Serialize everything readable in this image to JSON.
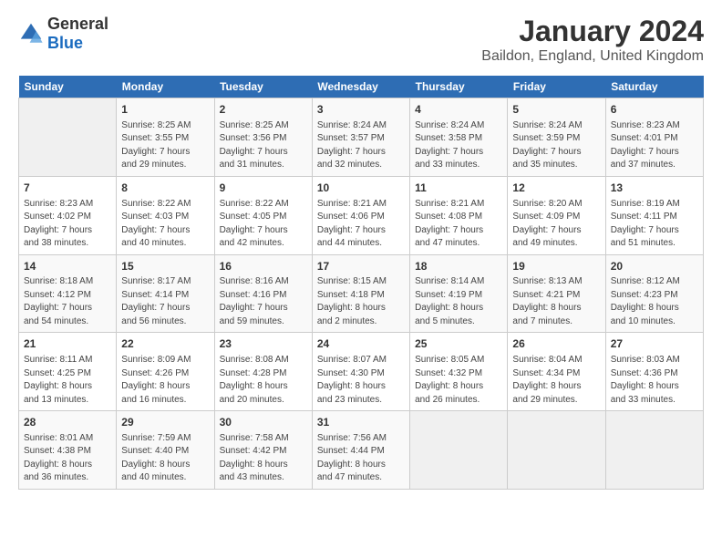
{
  "logo": {
    "text_general": "General",
    "text_blue": "Blue"
  },
  "header": {
    "title": "January 2024",
    "subtitle": "Baildon, England, United Kingdom"
  },
  "calendar": {
    "days_of_week": [
      "Sunday",
      "Monday",
      "Tuesday",
      "Wednesday",
      "Thursday",
      "Friday",
      "Saturday"
    ],
    "weeks": [
      [
        {
          "day": "",
          "detail": ""
        },
        {
          "day": "1",
          "detail": "Sunrise: 8:25 AM\nSunset: 3:55 PM\nDaylight: 7 hours\nand 29 minutes."
        },
        {
          "day": "2",
          "detail": "Sunrise: 8:25 AM\nSunset: 3:56 PM\nDaylight: 7 hours\nand 31 minutes."
        },
        {
          "day": "3",
          "detail": "Sunrise: 8:24 AM\nSunset: 3:57 PM\nDaylight: 7 hours\nand 32 minutes."
        },
        {
          "day": "4",
          "detail": "Sunrise: 8:24 AM\nSunset: 3:58 PM\nDaylight: 7 hours\nand 33 minutes."
        },
        {
          "day": "5",
          "detail": "Sunrise: 8:24 AM\nSunset: 3:59 PM\nDaylight: 7 hours\nand 35 minutes."
        },
        {
          "day": "6",
          "detail": "Sunrise: 8:23 AM\nSunset: 4:01 PM\nDaylight: 7 hours\nand 37 minutes."
        }
      ],
      [
        {
          "day": "7",
          "detail": "Sunrise: 8:23 AM\nSunset: 4:02 PM\nDaylight: 7 hours\nand 38 minutes."
        },
        {
          "day": "8",
          "detail": "Sunrise: 8:22 AM\nSunset: 4:03 PM\nDaylight: 7 hours\nand 40 minutes."
        },
        {
          "day": "9",
          "detail": "Sunrise: 8:22 AM\nSunset: 4:05 PM\nDaylight: 7 hours\nand 42 minutes."
        },
        {
          "day": "10",
          "detail": "Sunrise: 8:21 AM\nSunset: 4:06 PM\nDaylight: 7 hours\nand 44 minutes."
        },
        {
          "day": "11",
          "detail": "Sunrise: 8:21 AM\nSunset: 4:08 PM\nDaylight: 7 hours\nand 47 minutes."
        },
        {
          "day": "12",
          "detail": "Sunrise: 8:20 AM\nSunset: 4:09 PM\nDaylight: 7 hours\nand 49 minutes."
        },
        {
          "day": "13",
          "detail": "Sunrise: 8:19 AM\nSunset: 4:11 PM\nDaylight: 7 hours\nand 51 minutes."
        }
      ],
      [
        {
          "day": "14",
          "detail": "Sunrise: 8:18 AM\nSunset: 4:12 PM\nDaylight: 7 hours\nand 54 minutes."
        },
        {
          "day": "15",
          "detail": "Sunrise: 8:17 AM\nSunset: 4:14 PM\nDaylight: 7 hours\nand 56 minutes."
        },
        {
          "day": "16",
          "detail": "Sunrise: 8:16 AM\nSunset: 4:16 PM\nDaylight: 7 hours\nand 59 minutes."
        },
        {
          "day": "17",
          "detail": "Sunrise: 8:15 AM\nSunset: 4:18 PM\nDaylight: 8 hours\nand 2 minutes."
        },
        {
          "day": "18",
          "detail": "Sunrise: 8:14 AM\nSunset: 4:19 PM\nDaylight: 8 hours\nand 5 minutes."
        },
        {
          "day": "19",
          "detail": "Sunrise: 8:13 AM\nSunset: 4:21 PM\nDaylight: 8 hours\nand 7 minutes."
        },
        {
          "day": "20",
          "detail": "Sunrise: 8:12 AM\nSunset: 4:23 PM\nDaylight: 8 hours\nand 10 minutes."
        }
      ],
      [
        {
          "day": "21",
          "detail": "Sunrise: 8:11 AM\nSunset: 4:25 PM\nDaylight: 8 hours\nand 13 minutes."
        },
        {
          "day": "22",
          "detail": "Sunrise: 8:09 AM\nSunset: 4:26 PM\nDaylight: 8 hours\nand 16 minutes."
        },
        {
          "day": "23",
          "detail": "Sunrise: 8:08 AM\nSunset: 4:28 PM\nDaylight: 8 hours\nand 20 minutes."
        },
        {
          "day": "24",
          "detail": "Sunrise: 8:07 AM\nSunset: 4:30 PM\nDaylight: 8 hours\nand 23 minutes."
        },
        {
          "day": "25",
          "detail": "Sunrise: 8:05 AM\nSunset: 4:32 PM\nDaylight: 8 hours\nand 26 minutes."
        },
        {
          "day": "26",
          "detail": "Sunrise: 8:04 AM\nSunset: 4:34 PM\nDaylight: 8 hours\nand 29 minutes."
        },
        {
          "day": "27",
          "detail": "Sunrise: 8:03 AM\nSunset: 4:36 PM\nDaylight: 8 hours\nand 33 minutes."
        }
      ],
      [
        {
          "day": "28",
          "detail": "Sunrise: 8:01 AM\nSunset: 4:38 PM\nDaylight: 8 hours\nand 36 minutes."
        },
        {
          "day": "29",
          "detail": "Sunrise: 7:59 AM\nSunset: 4:40 PM\nDaylight: 8 hours\nand 40 minutes."
        },
        {
          "day": "30",
          "detail": "Sunrise: 7:58 AM\nSunset: 4:42 PM\nDaylight: 8 hours\nand 43 minutes."
        },
        {
          "day": "31",
          "detail": "Sunrise: 7:56 AM\nSunset: 4:44 PM\nDaylight: 8 hours\nand 47 minutes."
        },
        {
          "day": "",
          "detail": ""
        },
        {
          "day": "",
          "detail": ""
        },
        {
          "day": "",
          "detail": ""
        }
      ]
    ]
  }
}
